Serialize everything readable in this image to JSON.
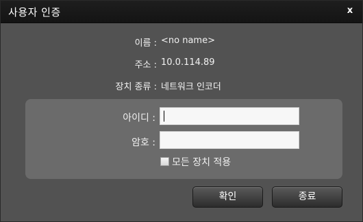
{
  "window": {
    "title": "사용자 인증",
    "close_glyph": "x"
  },
  "info": {
    "name_label": "이름 :",
    "name_value": "<no name>",
    "address_label": "주소 :",
    "address_value": "10.0.114.89",
    "device_type_label": "장치 종류 :",
    "device_type_value": "네트워크 인코더"
  },
  "form": {
    "id_label": "아이디 :",
    "id_value": "",
    "password_label": "암호 :",
    "password_value": "",
    "apply_all_label": "모든 장치 적용",
    "apply_all_checked": false
  },
  "buttons": {
    "ok_label": "확인",
    "cancel_label": "종료"
  },
  "colors": {
    "dialog_bg": "#525252",
    "titlebar_bg": "#1a1a1a",
    "panel_bg": "#6b6b6b"
  },
  "icons": {
    "close": "close-icon",
    "checkbox": "checkbox-icon"
  }
}
